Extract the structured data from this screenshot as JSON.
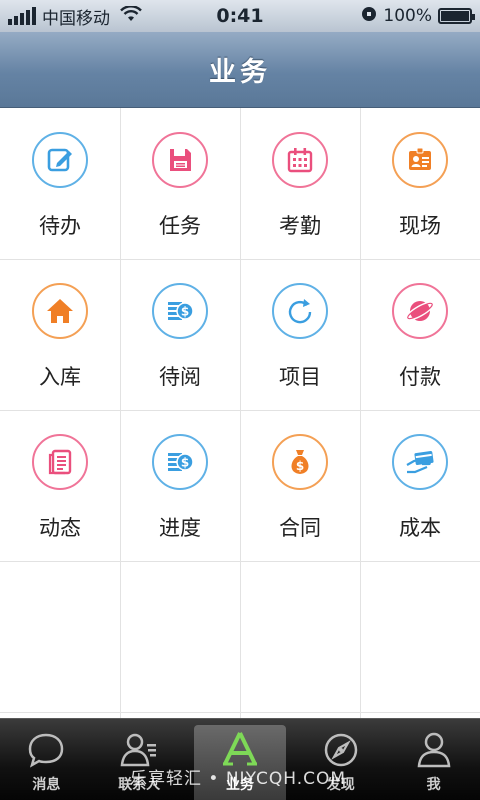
{
  "status_bar": {
    "carrier": "中国移动",
    "time": "0:41",
    "battery": "100%",
    "battery_level": 1.0
  },
  "header": {
    "title": "业务"
  },
  "grid": {
    "items": [
      {
        "label": "待办",
        "icon": "edit-icon",
        "color": "#3a9ee0"
      },
      {
        "label": "任务",
        "icon": "floppy-disk-icon",
        "color": "#ea4f7d"
      },
      {
        "label": "考勤",
        "icon": "calendar-icon",
        "color": "#ea4f7d"
      },
      {
        "label": "现场",
        "icon": "id-badge-icon",
        "color": "#f07f26"
      },
      {
        "label": "入库",
        "icon": "home-icon",
        "color": "#f07f26"
      },
      {
        "label": "待阅",
        "icon": "coin-stack-icon",
        "color": "#3a9ee0"
      },
      {
        "label": "项目",
        "icon": "refresh-icon",
        "color": "#3a9ee0"
      },
      {
        "label": "付款",
        "icon": "planet-icon",
        "color": "#ea4f7d"
      },
      {
        "label": "动态",
        "icon": "document-icon",
        "color": "#ea4f7d"
      },
      {
        "label": "进度",
        "icon": "coin-stack-icon",
        "color": "#3a9ee0"
      },
      {
        "label": "合同",
        "icon": "money-bag-icon",
        "color": "#f07f26"
      },
      {
        "label": "成本",
        "icon": "card-payment-icon",
        "color": "#3a9ee0"
      }
    ]
  },
  "tabs": [
    {
      "label": "消息",
      "icon": "chat-bubble-icon"
    },
    {
      "label": "联系人",
      "icon": "contacts-icon"
    },
    {
      "label": "业务",
      "icon": "app-store-icon",
      "active": true,
      "accent": "#7ed957"
    },
    {
      "label": "发现",
      "icon": "compass-icon"
    },
    {
      "label": "我",
      "icon": "person-icon"
    }
  ],
  "watermark": "乐享轻汇 • NIYCQH.COM"
}
